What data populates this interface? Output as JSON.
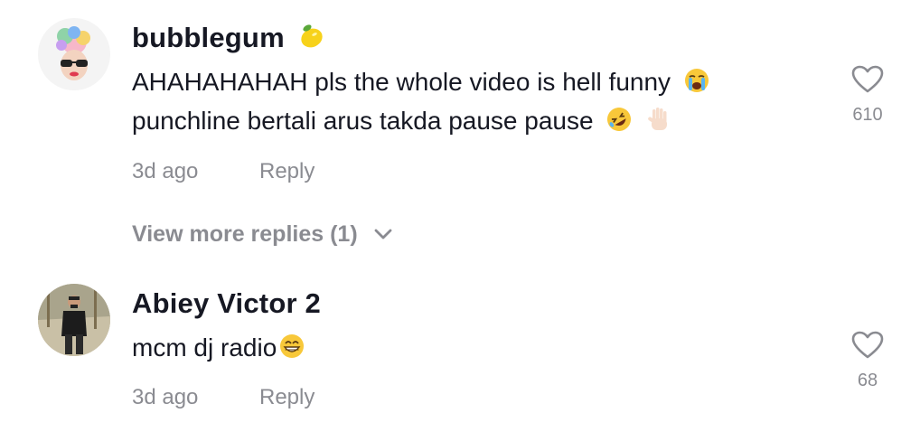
{
  "comments": [
    {
      "username": "bubblegum",
      "username_emoji": "lemon-emoji",
      "lines": [
        "AHAHAHAHAH pls the whole video is hell funny",
        "punchline bertali arus takda pause pause"
      ],
      "line_emojis": [
        [
          "loudly-crying-face-emoji"
        ],
        [
          "rolling-on-floor-laughing-emoji",
          "raised-hand-emoji"
        ]
      ],
      "time": "3d ago",
      "reply_label": "Reply",
      "like_count": "610"
    },
    {
      "username": "Abiey Victor 2",
      "lines": [
        "mcm dj radio"
      ],
      "line_emojis": [
        [
          "grinning-face-emoji"
        ]
      ],
      "time": "3d ago",
      "reply_label": "Reply",
      "like_count": "68"
    }
  ],
  "view_more": {
    "label": "View more replies (1)"
  },
  "colors": {
    "text_primary": "#161823",
    "text_secondary": "#8a8b91"
  }
}
